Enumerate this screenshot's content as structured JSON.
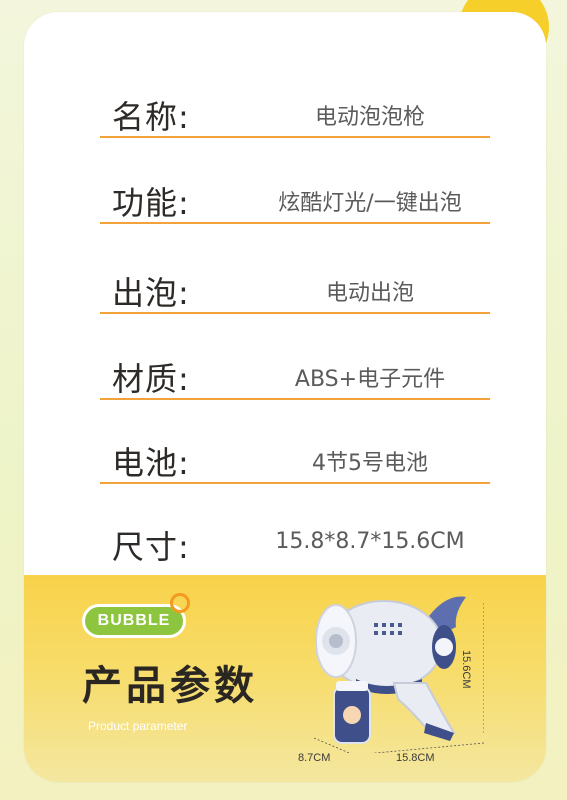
{
  "specs": [
    {
      "label": "名称:",
      "value": "电动泡泡枪"
    },
    {
      "label": "功能:",
      "value": "炫酷灯光/一键出泡"
    },
    {
      "label": "出泡:",
      "value": "电动出泡"
    },
    {
      "label": "材质:",
      "value": "ABS+电子元件"
    },
    {
      "label": "电池:",
      "value": "4节5号电池"
    },
    {
      "label": "尺寸:",
      "value": "15.8*8.7*15.6CM"
    }
  ],
  "footer": {
    "badge": "BUBBLE",
    "title": "产品参数",
    "subtitle": "Product parameter",
    "dimensions": {
      "depth": "8.7CM",
      "length": "15.8CM",
      "height": "15.6CM"
    }
  },
  "colors": {
    "divider": "#f2a23a",
    "badge": "#8ec53f",
    "footer_bg": "#f8d24a"
  }
}
